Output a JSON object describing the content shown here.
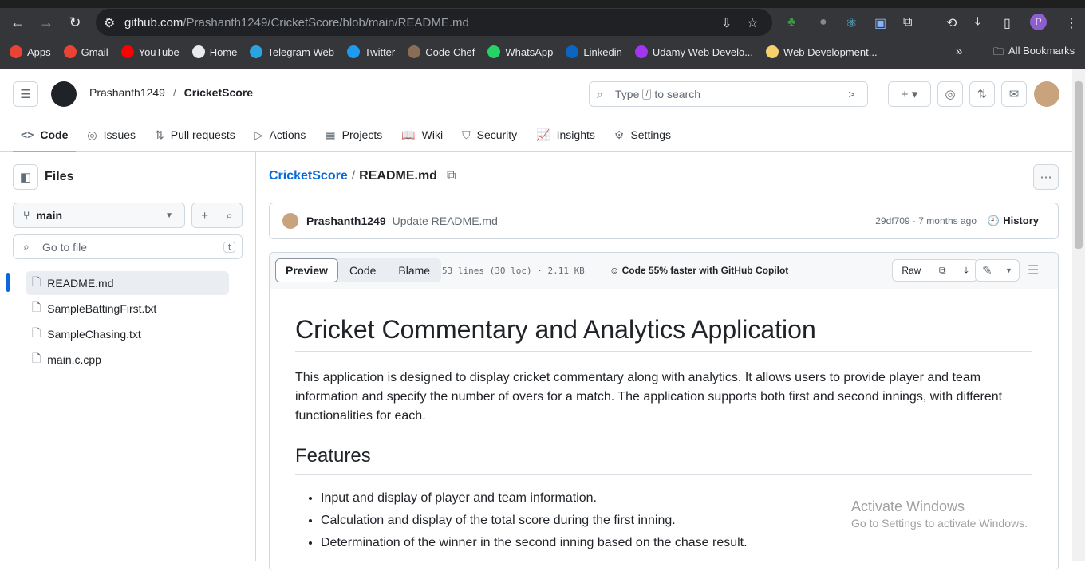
{
  "browser": {
    "url_host": "github.com",
    "url_path": "/Prashanth1249/CricketScore/blob/main/README.md",
    "profile_initial": "P",
    "bookmarks": [
      {
        "label": "Apps",
        "color": "#ea4335"
      },
      {
        "label": "Gmail",
        "color": "#ea4335"
      },
      {
        "label": "YouTube",
        "color": "#ff0000"
      },
      {
        "label": "Home",
        "color": "#e8eaed"
      },
      {
        "label": "Telegram Web",
        "color": "#2aa3df"
      },
      {
        "label": "Twitter",
        "color": "#1d9bf0"
      },
      {
        "label": "Code Chef",
        "color": "#8a6d55"
      },
      {
        "label": "WhatsApp",
        "color": "#25d366"
      },
      {
        "label": "Linkedin",
        "color": "#0a66c2"
      },
      {
        "label": "Udamy Web Develo...",
        "color": "#a435f0"
      },
      {
        "label": "Web Development...",
        "color": "#f5d06f"
      }
    ],
    "all_bookmarks": "All Bookmarks"
  },
  "header": {
    "owner": "Prashanth1249",
    "sep": "/",
    "repo": "CricketScore",
    "search_prefix": "Type",
    "search_key": "/",
    "search_suffix": "to search"
  },
  "tabs": [
    {
      "label": "Code",
      "icon": "<>"
    },
    {
      "label": "Issues",
      "icon": "◎"
    },
    {
      "label": "Pull requests",
      "icon": "⇅"
    },
    {
      "label": "Actions",
      "icon": "▷"
    },
    {
      "label": "Projects",
      "icon": "▦"
    },
    {
      "label": "Wiki",
      "icon": "📖"
    },
    {
      "label": "Security",
      "icon": "⛉"
    },
    {
      "label": "Insights",
      "icon": "📈"
    },
    {
      "label": "Settings",
      "icon": "⚙"
    }
  ],
  "sidebar": {
    "title": "Files",
    "branch": "main",
    "goto_placeholder": "Go to file",
    "goto_key": "t",
    "files": [
      "README.md",
      "SampleBattingFirst.txt",
      "SampleChasing.txt",
      "main.c.cpp"
    ]
  },
  "file": {
    "repo_link": "CricketScore",
    "sep": "/",
    "name": "README.md",
    "commit_author": "Prashanth1249",
    "commit_message": "Update README.md",
    "commit_meta": "29df709 · 7 months ago",
    "history": "History",
    "view_tabs": [
      "Preview",
      "Code",
      "Blame"
    ],
    "stats": "53 lines (30 loc) · 2.11 KB",
    "copilot": "Code 55% faster with GitHub Copilot",
    "raw": "Raw"
  },
  "readme": {
    "h1": "Cricket Commentary and Analytics Application",
    "intro": "This application is designed to display cricket commentary along with analytics. It allows users to provide player and team information and specify the number of overs for a match. The application supports both first and second innings, with different functionalities for each.",
    "h2": "Features",
    "features": [
      "Input and display of player and team information.",
      "Calculation and display of the total score during the first inning.",
      "Determination of the winner in the second inning based on the chase result."
    ]
  },
  "watermark": {
    "title": "Activate Windows",
    "subtitle": "Go to Settings to activate Windows."
  }
}
